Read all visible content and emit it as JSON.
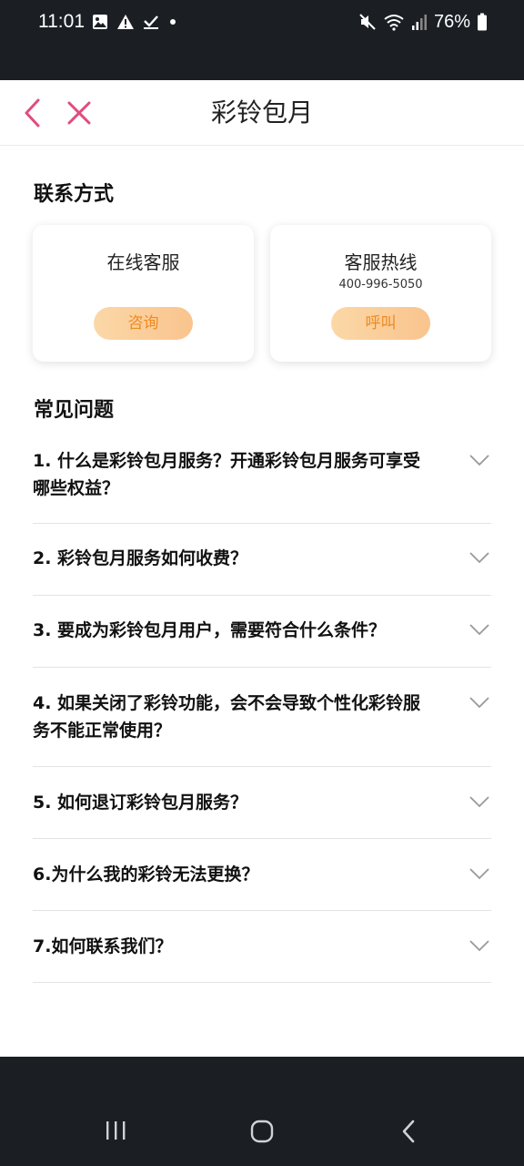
{
  "status_bar": {
    "time": "11:01",
    "battery_percent": "76%",
    "left_icons": [
      "image-icon",
      "warning-icon",
      "check-icon",
      "dot-icon"
    ],
    "right_icons": [
      "mute-icon",
      "wifi-icon",
      "signal-icon",
      "battery-icon"
    ]
  },
  "header": {
    "title": "彩铃包月",
    "accent_color": "#e14c7d"
  },
  "contact": {
    "section_title": "联系方式",
    "online": {
      "title": "在线客服",
      "button": "咨询"
    },
    "hotline": {
      "title": "客服热线",
      "number": "400-996-5050",
      "button": "呼叫"
    },
    "button_text_color": "#ee8a22"
  },
  "faq": {
    "section_title": "常见问题",
    "items": [
      {
        "question": "1. 什么是彩铃包月服务？开通彩铃包月服务可享受哪些权益？"
      },
      {
        "question": "2. 彩铃包月服务如何收费？"
      },
      {
        "question": "3. 要成为彩铃包月用户，需要符合什么条件？"
      },
      {
        "question": "4. 如果关闭了彩铃功能，会不会导致个性化彩铃服务不能正常使用？"
      },
      {
        "question": "5. 如何退订彩铃包月服务？"
      },
      {
        "question": "6.为什么我的彩铃无法更换？"
      },
      {
        "question": "7.如何联系我们？"
      }
    ]
  },
  "nav_bar": {
    "buttons": [
      "recent-apps-icon",
      "home-icon",
      "back-icon"
    ]
  }
}
